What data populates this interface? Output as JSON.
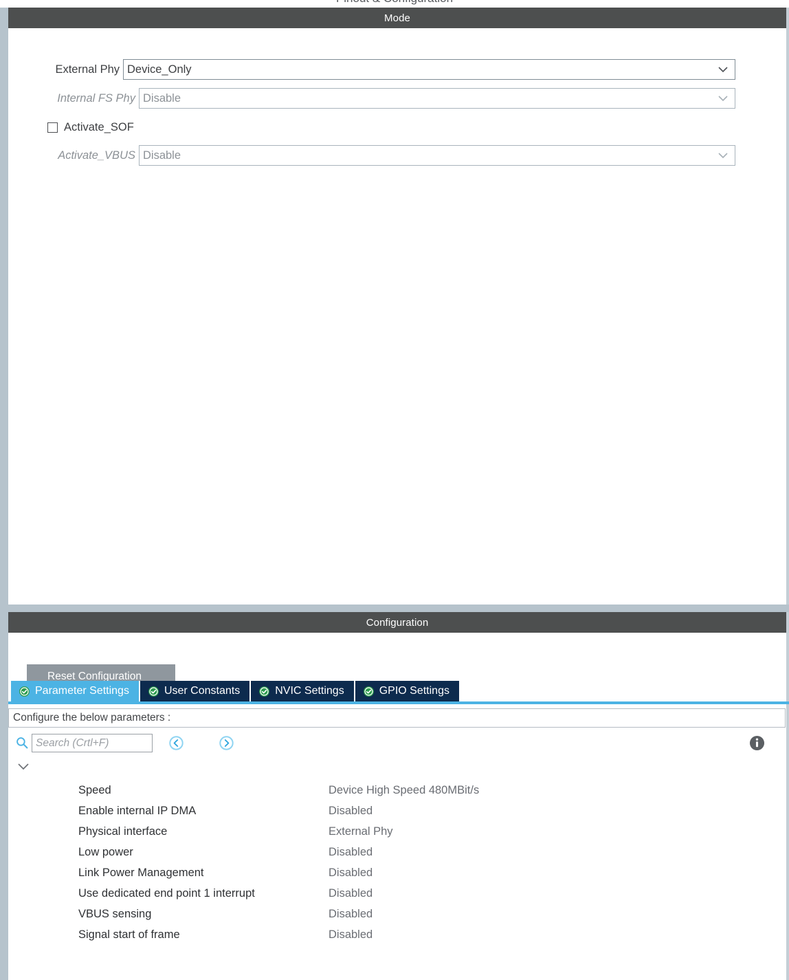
{
  "top_clipped_text": "Pinout & Configuration",
  "mode": {
    "header": "Mode",
    "fields": [
      {
        "label": "External Phy",
        "value": "Device_Only",
        "disabled": false,
        "type": "combo"
      },
      {
        "label": "Internal FS Phy",
        "value": "Disable",
        "disabled": true,
        "type": "combo"
      },
      {
        "label": "Activate_SOF",
        "value": "",
        "disabled": false,
        "type": "checkbox",
        "checked": false
      },
      {
        "label": "Activate_VBUS",
        "value": "Disable",
        "disabled": true,
        "type": "combo"
      }
    ]
  },
  "configuration": {
    "header": "Configuration",
    "reset_button": "Reset Configuration",
    "tabs": [
      {
        "label": "Parameter Settings",
        "active": true,
        "icon": "check-circle-icon"
      },
      {
        "label": "User Constants",
        "active": false,
        "icon": "check-circle-icon"
      },
      {
        "label": "NVIC Settings",
        "active": false,
        "icon": "check-circle-icon"
      },
      {
        "label": "GPIO Settings",
        "active": false,
        "icon": "check-circle-icon"
      }
    ],
    "configure_bar_text": "Configure the below parameters :",
    "search": {
      "placeholder": "Search (Crtl+F)",
      "value": ""
    },
    "parameters": [
      {
        "name": "Speed",
        "value": "Device High Speed 480MBit/s"
      },
      {
        "name": "Enable internal IP DMA",
        "value": "Disabled"
      },
      {
        "name": "Physical interface",
        "value": "External Phy"
      },
      {
        "name": "Low power",
        "value": "Disabled"
      },
      {
        "name": "Link Power Management",
        "value": "Disabled"
      },
      {
        "name": "Use dedicated end point 1 interrupt",
        "value": "Disabled"
      },
      {
        "name": "VBUS sensing",
        "value": "Disabled"
      },
      {
        "name": "Signal start of frame",
        "value": "Disabled"
      }
    ]
  },
  "colors": {
    "panel_header_bg": "#4d4f4f",
    "tab_active_bg": "#4cb3e4",
    "tab_inactive_bg": "#0d2b4e",
    "reset_button_bg": "#8f979e",
    "gutter": "#b6c3cc",
    "accent_blue": "#4cb3e4",
    "check_green": "#2e9e4f"
  }
}
